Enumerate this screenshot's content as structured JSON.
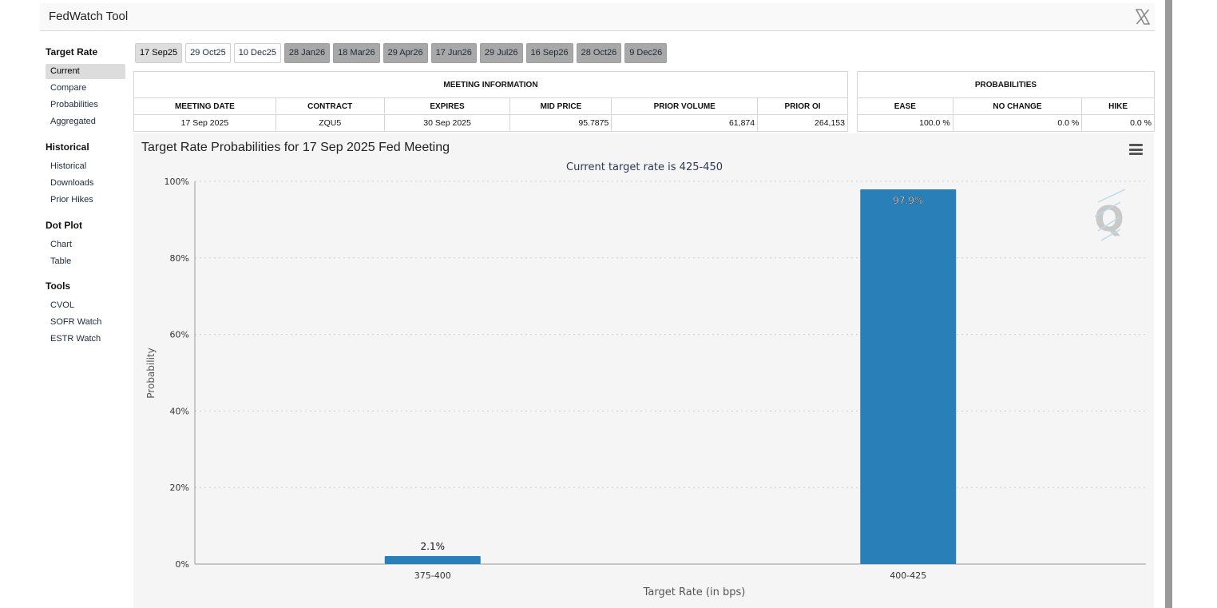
{
  "header": {
    "title": "FedWatch Tool",
    "icon": "x-logo-icon"
  },
  "sidebar": {
    "sections": [
      {
        "heading": "Target Rate",
        "items": [
          "Current",
          "Compare",
          "Probabilities",
          "Aggregated"
        ]
      },
      {
        "heading": "Historical",
        "items": [
          "Historical",
          "Downloads",
          "Prior Hikes"
        ]
      },
      {
        "heading": "Dot Plot",
        "items": [
          "Chart",
          "Table"
        ]
      },
      {
        "heading": "Tools",
        "items": [
          "CVOL",
          "SOFR Watch",
          "ESTR Watch"
        ]
      }
    ],
    "active_item": "Current"
  },
  "meeting_tabs": [
    {
      "label": "17 Sep25",
      "state": "active"
    },
    {
      "label": "29 Oct25",
      "state": "normal"
    },
    {
      "label": "10 Dec25",
      "state": "normal"
    },
    {
      "label": "28 Jan26",
      "state": "grey"
    },
    {
      "label": "18 Mar26",
      "state": "grey"
    },
    {
      "label": "29 Apr26",
      "state": "grey"
    },
    {
      "label": "17 Jun26",
      "state": "grey"
    },
    {
      "label": "29 Jul26",
      "state": "grey"
    },
    {
      "label": "16 Sep26",
      "state": "grey"
    },
    {
      "label": "28 Oct26",
      "state": "grey"
    },
    {
      "label": "9 Dec26",
      "state": "grey"
    }
  ],
  "meeting_info": {
    "caption": "MEETING INFORMATION",
    "headers": [
      "MEETING DATE",
      "CONTRACT",
      "EXPIRES",
      "MID PRICE",
      "PRIOR VOLUME",
      "PRIOR OI"
    ],
    "row": [
      "17 Sep 2025",
      "ZQU5",
      "30 Sep 2025",
      "95.7875",
      "61,874",
      "264,153"
    ]
  },
  "probabilities": {
    "caption": "PROBABILITIES",
    "headers": [
      "EASE",
      "NO CHANGE",
      "HIKE"
    ],
    "row": [
      "100.0 %",
      "0.0 %",
      "0.0 %"
    ]
  },
  "chart": {
    "title": "Target Rate Probabilities for 17 Sep 2025 Fed Meeting",
    "menu_icon": "hamburger-menu-icon",
    "watermark_icon": "q-logo-icon"
  },
  "chart_data": {
    "type": "bar",
    "subtitle": "Current target rate is 425-450",
    "categories": [
      "375-400",
      "400-425"
    ],
    "values": [
      2.1,
      97.9
    ],
    "data_labels": [
      "2.1%",
      "97.9%"
    ],
    "xlabel": "Target Rate (in bps)",
    "ylabel": "Probability",
    "ylim": [
      0,
      100
    ],
    "yticks": [
      "0%",
      "20%",
      "40%",
      "60%",
      "80%",
      "100%"
    ],
    "grid": true,
    "bar_color": "#2980b9"
  }
}
